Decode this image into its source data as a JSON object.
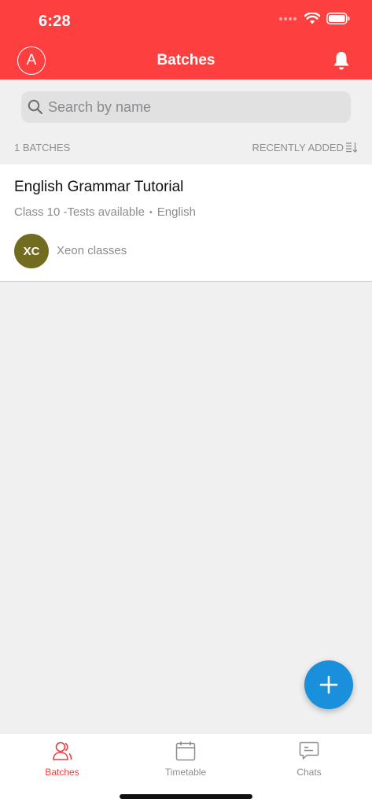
{
  "status_bar": {
    "time": "6:28"
  },
  "header": {
    "title": "Batches",
    "avatar_initial": "A",
    "bell_icon": "bell-icon"
  },
  "search": {
    "placeholder": "Search by name",
    "value": "",
    "icon": "search-icon"
  },
  "list_meta": {
    "count_label": "1 BATCHES",
    "sort_label": "RECENTLY ADDED",
    "sort_icon": "sort-icon"
  },
  "batches": [
    {
      "title": "English Grammar Tutorial",
      "class_info": "Class 10 -Tests available",
      "separator": "•",
      "subject": "English",
      "owner_initials": "XC",
      "owner_name": "Xeon classes"
    }
  ],
  "fab": {
    "icon": "plus-icon"
  },
  "tabs": [
    {
      "label": "Batches",
      "icon": "user-icon",
      "active": true
    },
    {
      "label": "Timetable",
      "icon": "calendar-icon",
      "active": false
    },
    {
      "label": "Chats",
      "icon": "chat-icon",
      "active": false
    }
  ],
  "colors": {
    "primary": "#fe3f40",
    "active_tab": "#f23a3c",
    "fab": "#1a90dc",
    "owner_avatar": "#726c20",
    "background": "#f0f0f0"
  }
}
